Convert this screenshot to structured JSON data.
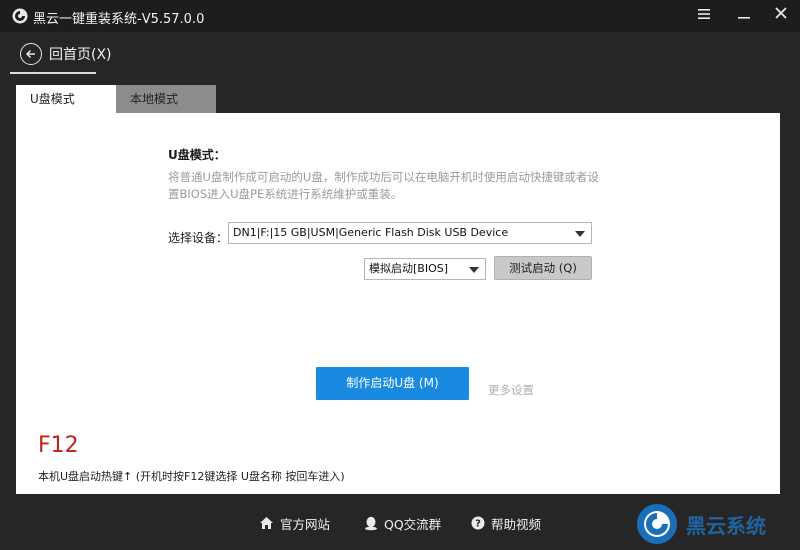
{
  "window": {
    "title": "黑云一键重装系统-V5.57.0.0",
    "menu_icon": "menu-icon",
    "minimize_icon": "minimize-icon",
    "close_icon": "close-icon"
  },
  "nav": {
    "home_label": "回首页(X)",
    "back_icon": "back-arrow-icon"
  },
  "tabs": [
    {
      "label": "U盘模式(&U)",
      "active": true
    },
    {
      "label": "本地模式(&P)",
      "active": false
    }
  ],
  "usb_mode": {
    "title": "U盘模式：",
    "description": "将普通U盘制作成可启动的U盘，制作成功后可以在电脑开机时使用启动快捷键或者设置BIOS进入U盘PE系统进行系统维护或重装。",
    "device_label": "选择设备：",
    "device_value": "DN1|F:|15 GB|USM|Generic Flash Disk USB Device",
    "boot_mode_value": "模拟启动[BIOS]",
    "test_boot_label": "测试启动 (Q)",
    "make_button_label": "制作启动U盘 (M)",
    "more_settings_label": "更多设置",
    "hotkey": "F12",
    "hotkey_desc": "本机U盘启动热键↑ (开机时按F12键选择 U盘名称 按回车进入)"
  },
  "footer": {
    "links": [
      {
        "label": "官方网站",
        "icon": "home-icon"
      },
      {
        "label": "QQ交流群",
        "icon": "qq-icon"
      },
      {
        "label": "帮助视频",
        "icon": "help-icon"
      }
    ]
  },
  "watermark": {
    "text": "黑云系统"
  },
  "colors": {
    "accent": "#1a8ae0",
    "hotkey": "#c0211b",
    "background": "#262626"
  }
}
